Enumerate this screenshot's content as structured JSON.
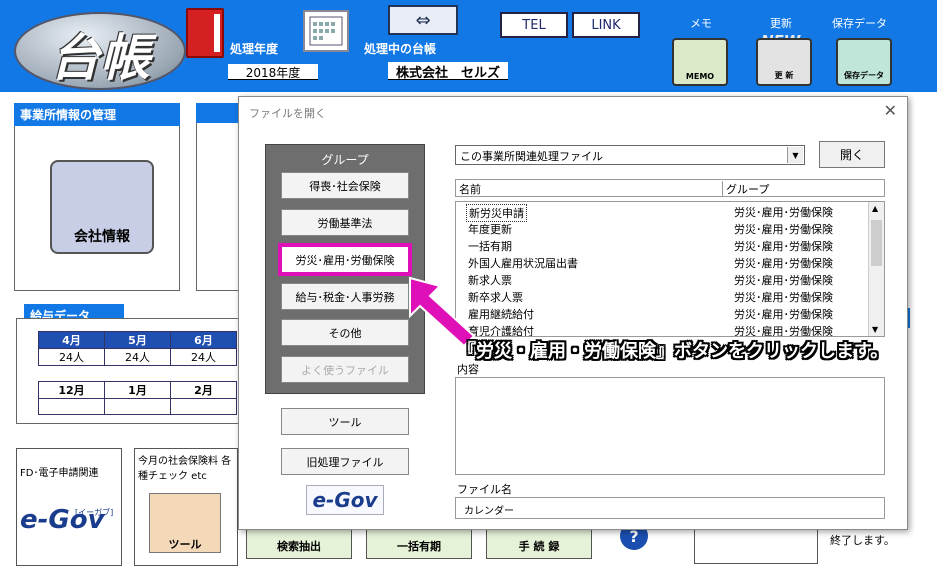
{
  "header": {
    "logo_text": "台帳",
    "fiscal_year_label": "処理年度",
    "fiscal_year_value": "2018年度",
    "current_ledger_label": "処理中の台帳",
    "current_ledger_value": "株式会社　セルズ",
    "tel_label": "TEL",
    "link_label": "LINK",
    "memo_caption": "メモ",
    "memo_icon_text": "MEMO",
    "update_caption": "更新",
    "update_icon_text": "更 新",
    "new_tag": "NEW",
    "savedata_caption": "保存データ",
    "savedata_icon_text": "保存データ"
  },
  "background": {
    "office_panel_title": "事業所情報の管理",
    "company_info_label": "会社情報",
    "salary_panel_title": "給与データ",
    "salary_rows": [
      {
        "months": [
          "4月",
          "5月",
          "6月"
        ],
        "values": [
          "24人",
          "24人",
          "24人"
        ]
      },
      {
        "months": [
          "12月",
          "1月",
          "2月"
        ],
        "values": [
          "",
          "",
          ""
        ]
      }
    ],
    "fd_box_text": "FD･電子申請関連",
    "egov_big": "e-Gov",
    "egov_sub": "[イーガブ]",
    "monthly_box_text": "今月の社会保険料 各種チェック etc",
    "tool_icon_label": "ツール",
    "search_btn": "検索抽出",
    "bulk_btn": "一括有期",
    "procedure_btn": "手 続 録",
    "help_icon": "?",
    "exit_text": "終了します。"
  },
  "dialog": {
    "title": "ファイルを開く",
    "close": "✕",
    "group_title": "グループ",
    "groups": [
      "得喪･社会保険",
      "労働基準法",
      "労災･雇用･労働保険",
      "給与･税金･人事労務",
      "その他",
      "よく使うファイル"
    ],
    "tool_button": "ツール",
    "old_files_button": "旧処理ファイル",
    "egov_small": "e-Gov",
    "select_value": "この事業所関連処理ファイル",
    "open_button": "開く",
    "col_name": "名前",
    "col_group": "グループ",
    "files": [
      {
        "name": "新労災申請",
        "group": "労災･雇用･労働保険"
      },
      {
        "name": "年度更新",
        "group": "労災･雇用･労働保険"
      },
      {
        "name": "一括有期",
        "group": "労災･雇用･労働保険"
      },
      {
        "name": "外国人雇用状況届出書",
        "group": "労災･雇用･労働保険"
      },
      {
        "name": "新求人票",
        "group": "労災･雇用･労働保険"
      },
      {
        "name": "新卒求人票",
        "group": "労災･雇用･労働保険"
      },
      {
        "name": "雇用継続給付",
        "group": "労災･雇用･労働保険"
      },
      {
        "name": "育児介護給付",
        "group": "労災･雇用･労働保険"
      }
    ],
    "content_label": "内容",
    "filename_label": "ファイル名",
    "filename_value": "カレンダー"
  },
  "callout_text": "『労災・雇用・労働保険』ボタンをクリックします。",
  "colors": {
    "accent": "#1178e6",
    "highlight": "#e010b8"
  }
}
